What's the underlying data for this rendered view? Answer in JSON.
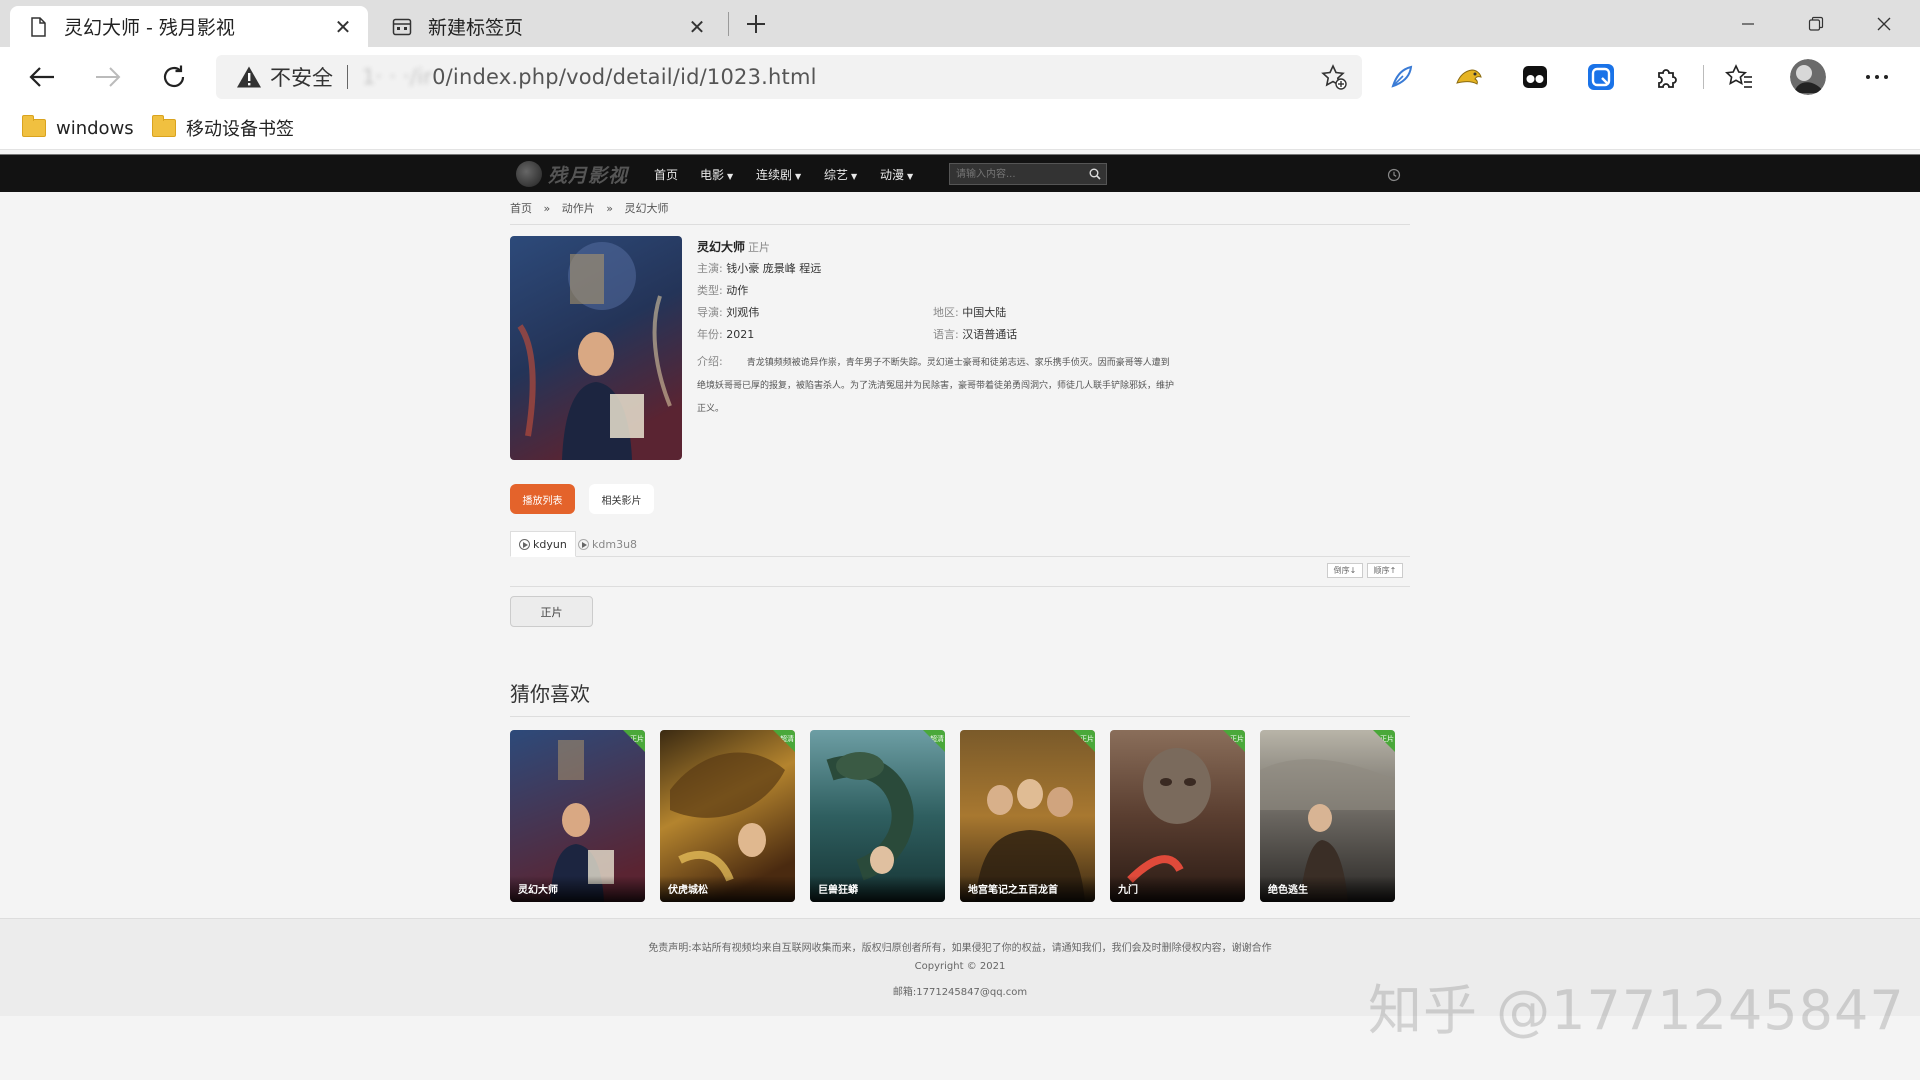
{
  "browser": {
    "tabs": [
      {
        "title": "灵幻大师 - 残月影视",
        "active": true
      },
      {
        "title": "新建标签页",
        "active": false
      }
    ],
    "address": {
      "insecure_label": "不安全",
      "url_hidden": "1‧  ‧ ‧/ir",
      "url": "0/index.php/vod/detail/id/1023.html"
    },
    "bookmarks": [
      {
        "label": "windows"
      },
      {
        "label": "移动设备书签"
      }
    ]
  },
  "site": {
    "logo": "残月影视",
    "nav": [
      {
        "label": "首页",
        "dropdown": false
      },
      {
        "label": "电影",
        "dropdown": true
      },
      {
        "label": "连续剧",
        "dropdown": true
      },
      {
        "label": "综艺",
        "dropdown": true
      },
      {
        "label": "动漫",
        "dropdown": true
      }
    ],
    "search_placeholder": "请输入内容..."
  },
  "breadcrumb": [
    "首页",
    "»",
    "动作片",
    "»",
    "灵幻大师"
  ],
  "detail": {
    "title": "灵幻大师",
    "title_tag": "正片",
    "cast_label": "主演:",
    "cast": "钱小豪 庞景峰 程远",
    "genre_label": "类型:",
    "genre": "动作",
    "director_label": "导演:",
    "director": "刘观伟",
    "region_label": "地区:",
    "region": "中国大陆",
    "year_label": "年份:",
    "year": "2021",
    "lang_label": "语言:",
    "lang": "汉语普通话",
    "intro_label": "介绍:",
    "intro": "青龙镇频频被诡异作祟，青年男子不断失踪。灵幻道士豪哥和徒弟志远、家乐携手侦灭。因而豪哥等人遭到绝境妖哥哥已厚的报复，被陷害杀人。为了洗清冤屈并为民除害，豪哥带着徒弟勇闯洞穴，师徒几人联手铲除邪妖，维护正义。"
  },
  "tabs": {
    "playlist": "播放列表",
    "related": "相关影片"
  },
  "sources": [
    "kdyun",
    "kdm3u8"
  ],
  "sort": {
    "reverse": "倒序↓",
    "forward": "顺序↑"
  },
  "episode": "正片",
  "recommend": {
    "title": "猜你喜欢",
    "items": [
      {
        "name": "灵幻大师",
        "badge": "正片",
        "color_a": "#2a3f6b",
        "color_b": "#6c2c3a"
      },
      {
        "name": "伏虎城松",
        "badge": "超清",
        "color_a": "#5a3a14",
        "color_b": "#c58a2f"
      },
      {
        "name": "巨兽狂蟒",
        "badge": "超清",
        "color_a": "#1f4a4a",
        "color_b": "#6a9aa0"
      },
      {
        "name": "地宫笔记之五百龙首",
        "badge": "正片",
        "color_a": "#4a3418",
        "color_b": "#b07a30"
      },
      {
        "name": "九门",
        "badge": "正片",
        "color_a": "#3a2a22",
        "color_b": "#8a5d45"
      },
      {
        "name": "绝色逃生",
        "badge": "正片",
        "color_a": "#3a3a3a",
        "color_b": "#8f8a80"
      }
    ]
  },
  "footer": {
    "disclaimer": "免责声明:本站所有视频均来自互联网收集而来，版权归原创者所有，如果侵犯了你的权益，请通知我们，我们会及时删除侵权内容，谢谢合作",
    "copyright": "Copyright © 2021",
    "email": "邮箱:1771245847@qq.com"
  },
  "watermark": "知乎 @1771245847",
  "colors": {
    "accent": "#e4632b",
    "nav_bg": "#121212",
    "badge": "#4aa83a"
  }
}
